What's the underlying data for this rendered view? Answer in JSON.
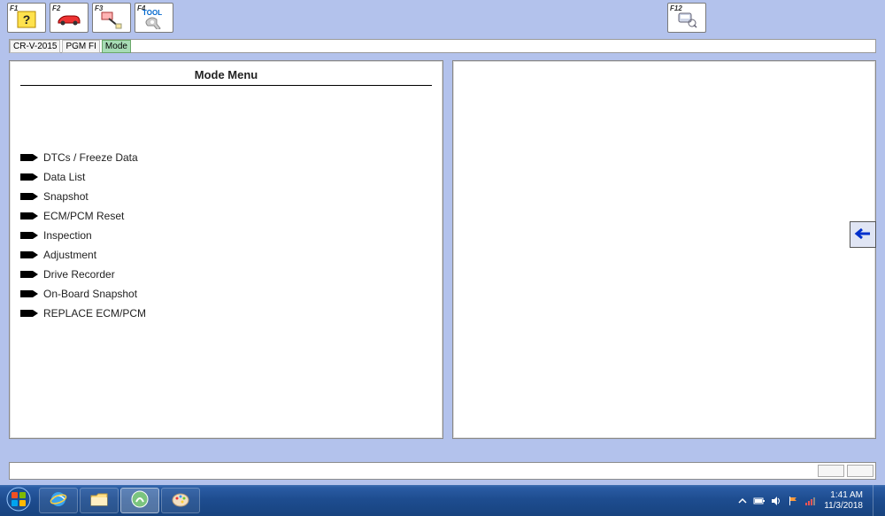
{
  "toolbar": {
    "f1": {
      "label": "F1"
    },
    "f2": {
      "label": "F2"
    },
    "f3": {
      "label": "F3"
    },
    "f4": {
      "label": "F4",
      "text": "TOOL"
    },
    "f12": {
      "label": "F12"
    }
  },
  "breadcrumb": {
    "items": [
      {
        "label": "CR-V-2015",
        "active": false
      },
      {
        "label": "PGM FI",
        "active": false
      },
      {
        "label": "Mode",
        "active": true
      }
    ]
  },
  "panel": {
    "title": "Mode Menu",
    "items": [
      {
        "label": "DTCs / Freeze Data"
      },
      {
        "label": "Data List"
      },
      {
        "label": "Snapshot"
      },
      {
        "label": "ECM/PCM Reset"
      },
      {
        "label": "Inspection"
      },
      {
        "label": "Adjustment"
      },
      {
        "label": "Drive Recorder"
      },
      {
        "label": "On-Board Snapshot"
      },
      {
        "label": "REPLACE ECM/PCM"
      }
    ]
  },
  "taskbar": {
    "time": "1:41 AM",
    "date": "11/3/2018"
  }
}
